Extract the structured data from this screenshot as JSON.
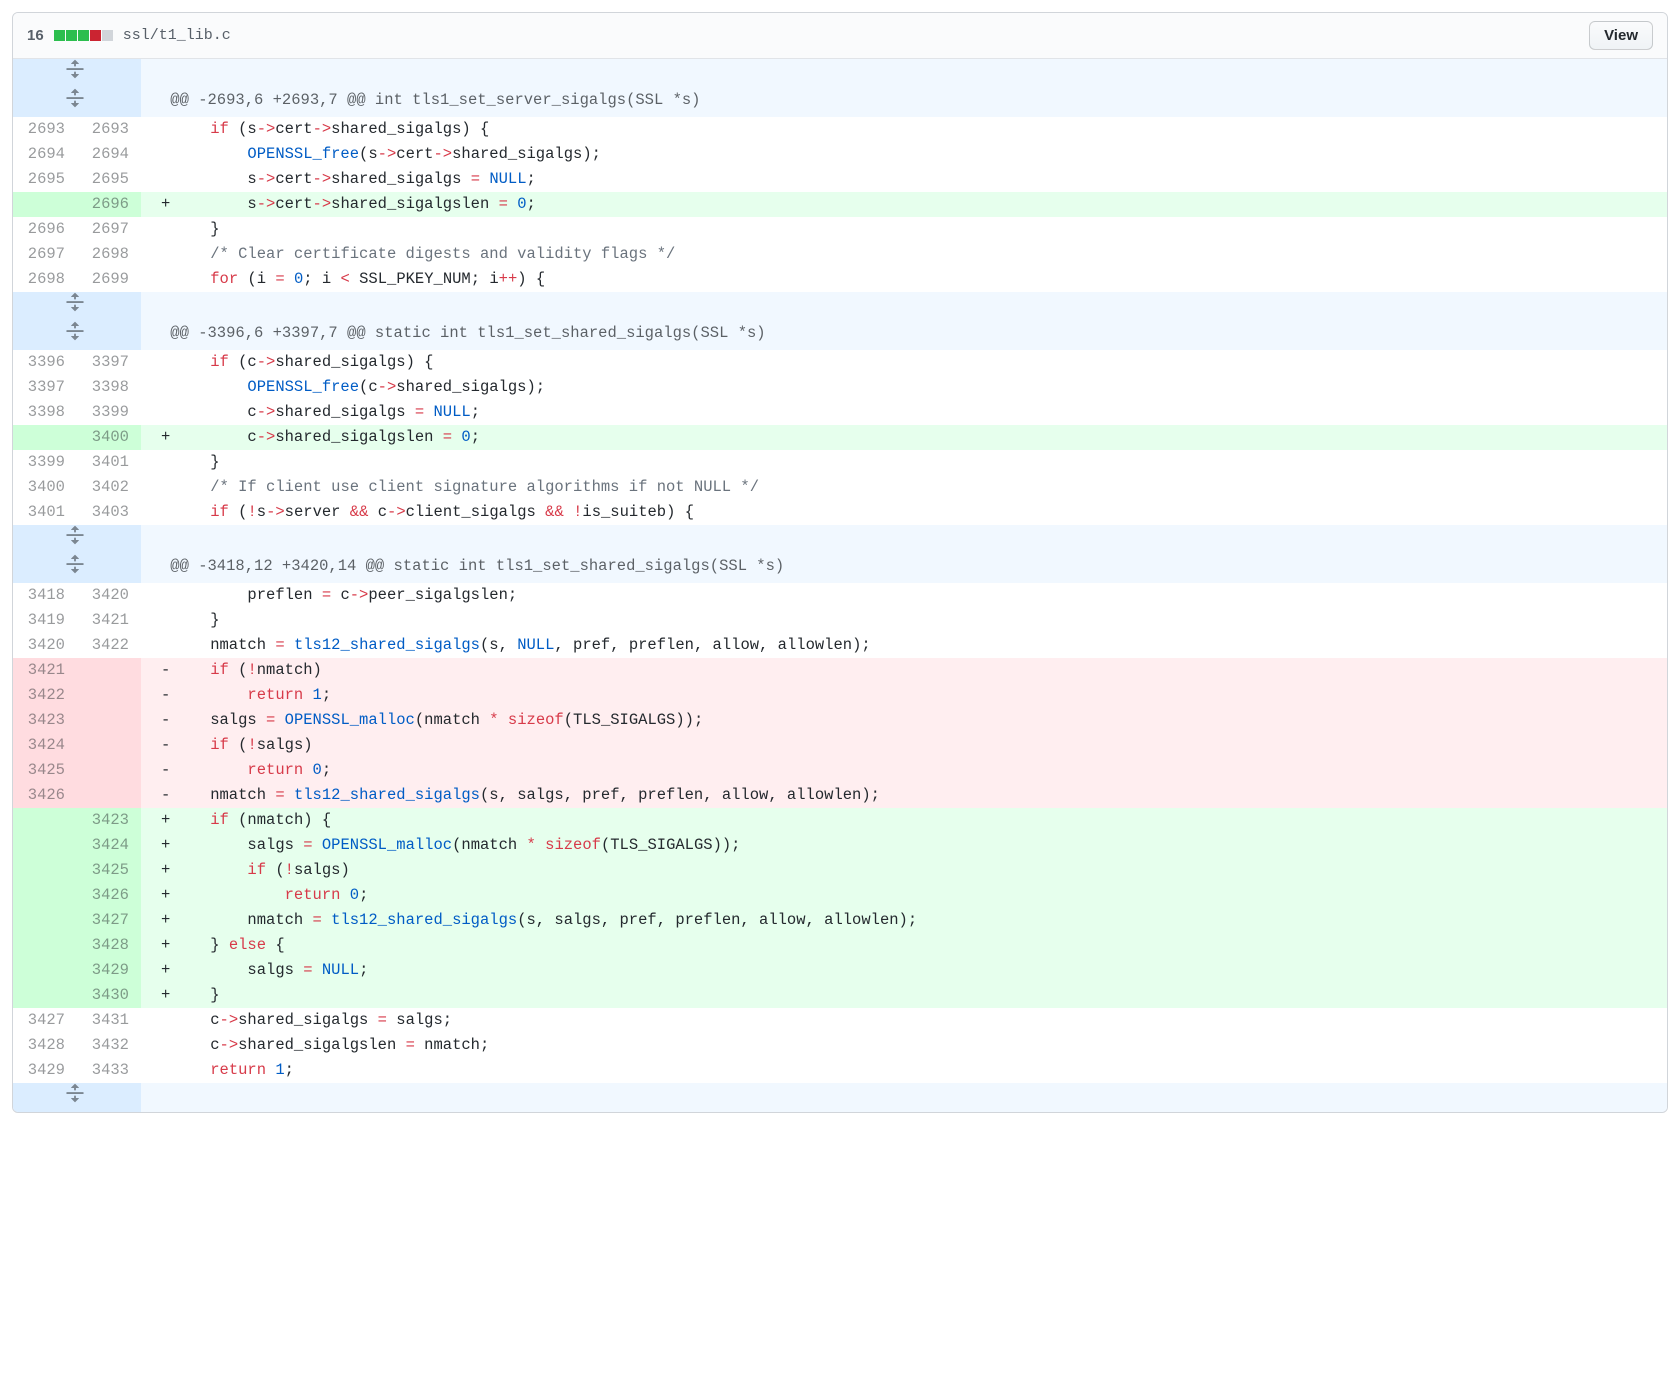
{
  "header": {
    "change_count": "16",
    "filename": "ssl/t1_lib.c",
    "view_button": "View",
    "diffstat": [
      "add",
      "add",
      "add",
      "del",
      "neu"
    ]
  },
  "rows": [
    {
      "type": "exp"
    },
    {
      "type": "hunk",
      "text": "@@ -2693,6 +2693,7 @@ int tls1_set_server_sigalgs(SSL *s)"
    },
    {
      "type": "ctx",
      "ol": "2693",
      "nl": "2693",
      "html": "    <span class='k'>if</span> (s<span class='op'>-&gt;</span>cert<span class='op'>-&gt;</span>shared_sigalgs) {"
    },
    {
      "type": "ctx",
      "ol": "2694",
      "nl": "2694",
      "html": "        <span class='fn'>OPENSSL_free</span>(s<span class='op'>-&gt;</span>cert<span class='op'>-&gt;</span>shared_sigalgs);"
    },
    {
      "type": "ctx",
      "ol": "2695",
      "nl": "2695",
      "html": "        s<span class='op'>-&gt;</span>cert<span class='op'>-&gt;</span>shared_sigalgs <span class='op'>=</span> <span class='n'>NULL</span>;"
    },
    {
      "type": "add",
      "ol": "",
      "nl": "2696",
      "html": "        s<span class='op'>-&gt;</span>cert<span class='op'>-&gt;</span>shared_sigalgslen <span class='op'>=</span> <span class='n'>0</span>;"
    },
    {
      "type": "ctx",
      "ol": "2696",
      "nl": "2697",
      "html": "    }"
    },
    {
      "type": "ctx",
      "ol": "2697",
      "nl": "2698",
      "html": "    <span class='c'>/* Clear certificate digests and validity flags */</span>"
    },
    {
      "type": "ctx",
      "ol": "2698",
      "nl": "2699",
      "html": "    <span class='k'>for</span> (i <span class='op'>=</span> <span class='n'>0</span>; i <span class='op'>&lt;</span> SSL_PKEY_NUM; i<span class='op'>++</span>) {"
    },
    {
      "type": "exp"
    },
    {
      "type": "hunk",
      "text": "@@ -3396,6 +3397,7 @@ static int tls1_set_shared_sigalgs(SSL *s)"
    },
    {
      "type": "ctx",
      "ol": "3396",
      "nl": "3397",
      "html": "    <span class='k'>if</span> (c<span class='op'>-&gt;</span>shared_sigalgs) {"
    },
    {
      "type": "ctx",
      "ol": "3397",
      "nl": "3398",
      "html": "        <span class='fn'>OPENSSL_free</span>(c<span class='op'>-&gt;</span>shared_sigalgs);"
    },
    {
      "type": "ctx",
      "ol": "3398",
      "nl": "3399",
      "html": "        c<span class='op'>-&gt;</span>shared_sigalgs <span class='op'>=</span> <span class='n'>NULL</span>;"
    },
    {
      "type": "add",
      "ol": "",
      "nl": "3400",
      "html": "        c<span class='op'>-&gt;</span>shared_sigalgslen <span class='op'>=</span> <span class='n'>0</span>;"
    },
    {
      "type": "ctx",
      "ol": "3399",
      "nl": "3401",
      "html": "    }"
    },
    {
      "type": "ctx",
      "ol": "3400",
      "nl": "3402",
      "html": "    <span class='c'>/* If client use client signature algorithms if not NULL */</span>"
    },
    {
      "type": "ctx",
      "ol": "3401",
      "nl": "3403",
      "html": "    <span class='k'>if</span> (<span class='op'>!</span>s<span class='op'>-&gt;</span>server <span class='op'>&amp;&amp;</span> c<span class='op'>-&gt;</span>client_sigalgs <span class='op'>&amp;&amp;</span> <span class='op'>!</span>is_suiteb) {"
    },
    {
      "type": "exp"
    },
    {
      "type": "hunk",
      "text": "@@ -3418,12 +3420,14 @@ static int tls1_set_shared_sigalgs(SSL *s)"
    },
    {
      "type": "ctx",
      "ol": "3418",
      "nl": "3420",
      "html": "        preflen <span class='op'>=</span> c<span class='op'>-&gt;</span>peer_sigalgslen;"
    },
    {
      "type": "ctx",
      "ol": "3419",
      "nl": "3421",
      "html": "    }"
    },
    {
      "type": "ctx",
      "ol": "3420",
      "nl": "3422",
      "html": "    nmatch <span class='op'>=</span> <span class='fn'>tls12_shared_sigalgs</span>(s, <span class='n'>NULL</span>, pref, preflen, allow, allowlen);"
    },
    {
      "type": "del",
      "ol": "3421",
      "nl": "",
      "html": "    <span class='k'>if</span> (<span class='op'>!</span>nmatch)"
    },
    {
      "type": "del",
      "ol": "3422",
      "nl": "",
      "html": "        <span class='k'>return</span> <span class='n'>1</span>;"
    },
    {
      "type": "del",
      "ol": "3423",
      "nl": "",
      "html": "    salgs <span class='op'>=</span> <span class='fn'>OPENSSL_malloc</span>(nmatch <span class='op'>*</span> <span class='t'>sizeof</span>(TLS_SIGALGS));"
    },
    {
      "type": "del",
      "ol": "3424",
      "nl": "",
      "html": "    <span class='k'>if</span> (<span class='op'>!</span>salgs)"
    },
    {
      "type": "del",
      "ol": "3425",
      "nl": "",
      "html": "        <span class='k'>return</span> <span class='n'>0</span>;"
    },
    {
      "type": "del",
      "ol": "3426",
      "nl": "",
      "html": "    nmatch <span class='op'>=</span> <span class='fn'>tls12_shared_sigalgs</span>(s, salgs, pref, preflen, allow, allowlen);"
    },
    {
      "type": "add",
      "ol": "",
      "nl": "3423",
      "html": "    <span class='k'>if</span> (nmatch) {"
    },
    {
      "type": "add",
      "ol": "",
      "nl": "3424",
      "html": "        salgs <span class='op'>=</span> <span class='fn'>OPENSSL_malloc</span>(nmatch <span class='op'>*</span> <span class='t'>sizeof</span>(TLS_SIGALGS));"
    },
    {
      "type": "add",
      "ol": "",
      "nl": "3425",
      "html": "        <span class='k'>if</span> (<span class='op'>!</span>salgs)"
    },
    {
      "type": "add",
      "ol": "",
      "nl": "3426",
      "html": "            <span class='k'>return</span> <span class='n'>0</span>;"
    },
    {
      "type": "add",
      "ol": "",
      "nl": "3427",
      "html": "        nmatch <span class='op'>=</span> <span class='fn'>tls12_shared_sigalgs</span>(s, salgs, pref, preflen, allow, allowlen);"
    },
    {
      "type": "add",
      "ol": "",
      "nl": "3428",
      "html": "    } <span class='k'>else</span> {"
    },
    {
      "type": "add",
      "ol": "",
      "nl": "3429",
      "html": "        salgs <span class='op'>=</span> <span class='n'>NULL</span>;"
    },
    {
      "type": "add",
      "ol": "",
      "nl": "3430",
      "html": "    }"
    },
    {
      "type": "ctx",
      "ol": "3427",
      "nl": "3431",
      "html": "    c<span class='op'>-&gt;</span>shared_sigalgs <span class='op'>=</span> salgs;"
    },
    {
      "type": "ctx",
      "ol": "3428",
      "nl": "3432",
      "html": "    c<span class='op'>-&gt;</span>shared_sigalgslen <span class='op'>=</span> nmatch;"
    },
    {
      "type": "ctx",
      "ol": "3429",
      "nl": "3433",
      "html": "    <span class='k'>return</span> <span class='n'>1</span>;"
    },
    {
      "type": "exp"
    }
  ]
}
